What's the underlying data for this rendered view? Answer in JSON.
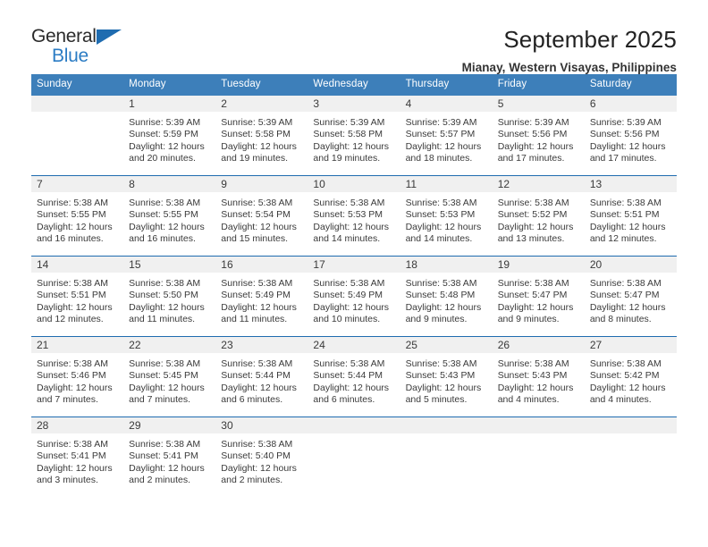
{
  "logo": {
    "text_top": "General",
    "text_bottom": "Blue",
    "triangle_icon": "blue-triangle-icon",
    "color_blue": "#2b7cc4",
    "color_dark": "#2b2b2b"
  },
  "header": {
    "title": "September 2025",
    "subtitle": "Mianay, Western Visayas, Philippines"
  },
  "theme": {
    "header_blue": "#3d7fba",
    "divider_blue": "#1f6cb0",
    "day_band_gray": "#f0f0f0"
  },
  "weekdays": [
    "Sunday",
    "Monday",
    "Tuesday",
    "Wednesday",
    "Thursday",
    "Friday",
    "Saturday"
  ],
  "labels": {
    "sunrise_prefix": "Sunrise: ",
    "sunset_prefix": "Sunset: ",
    "daylight_prefix": "Daylight: "
  },
  "weeks": [
    [
      {
        "day": "",
        "empty": true
      },
      {
        "day": "1",
        "sunrise": "Sunrise: 5:39 AM",
        "sunset": "Sunset: 5:59 PM",
        "daylight_l1": "Daylight: 12 hours",
        "daylight_l2": "and 20 minutes."
      },
      {
        "day": "2",
        "sunrise": "Sunrise: 5:39 AM",
        "sunset": "Sunset: 5:58 PM",
        "daylight_l1": "Daylight: 12 hours",
        "daylight_l2": "and 19 minutes."
      },
      {
        "day": "3",
        "sunrise": "Sunrise: 5:39 AM",
        "sunset": "Sunset: 5:58 PM",
        "daylight_l1": "Daylight: 12 hours",
        "daylight_l2": "and 19 minutes."
      },
      {
        "day": "4",
        "sunrise": "Sunrise: 5:39 AM",
        "sunset": "Sunset: 5:57 PM",
        "daylight_l1": "Daylight: 12 hours",
        "daylight_l2": "and 18 minutes."
      },
      {
        "day": "5",
        "sunrise": "Sunrise: 5:39 AM",
        "sunset": "Sunset: 5:56 PM",
        "daylight_l1": "Daylight: 12 hours",
        "daylight_l2": "and 17 minutes."
      },
      {
        "day": "6",
        "sunrise": "Sunrise: 5:39 AM",
        "sunset": "Sunset: 5:56 PM",
        "daylight_l1": "Daylight: 12 hours",
        "daylight_l2": "and 17 minutes."
      }
    ],
    [
      {
        "day": "7",
        "sunrise": "Sunrise: 5:38 AM",
        "sunset": "Sunset: 5:55 PM",
        "daylight_l1": "Daylight: 12 hours",
        "daylight_l2": "and 16 minutes."
      },
      {
        "day": "8",
        "sunrise": "Sunrise: 5:38 AM",
        "sunset": "Sunset: 5:55 PM",
        "daylight_l1": "Daylight: 12 hours",
        "daylight_l2": "and 16 minutes."
      },
      {
        "day": "9",
        "sunrise": "Sunrise: 5:38 AM",
        "sunset": "Sunset: 5:54 PM",
        "daylight_l1": "Daylight: 12 hours",
        "daylight_l2": "and 15 minutes."
      },
      {
        "day": "10",
        "sunrise": "Sunrise: 5:38 AM",
        "sunset": "Sunset: 5:53 PM",
        "daylight_l1": "Daylight: 12 hours",
        "daylight_l2": "and 14 minutes."
      },
      {
        "day": "11",
        "sunrise": "Sunrise: 5:38 AM",
        "sunset": "Sunset: 5:53 PM",
        "daylight_l1": "Daylight: 12 hours",
        "daylight_l2": "and 14 minutes."
      },
      {
        "day": "12",
        "sunrise": "Sunrise: 5:38 AM",
        "sunset": "Sunset: 5:52 PM",
        "daylight_l1": "Daylight: 12 hours",
        "daylight_l2": "and 13 minutes."
      },
      {
        "day": "13",
        "sunrise": "Sunrise: 5:38 AM",
        "sunset": "Sunset: 5:51 PM",
        "daylight_l1": "Daylight: 12 hours",
        "daylight_l2": "and 12 minutes."
      }
    ],
    [
      {
        "day": "14",
        "sunrise": "Sunrise: 5:38 AM",
        "sunset": "Sunset: 5:51 PM",
        "daylight_l1": "Daylight: 12 hours",
        "daylight_l2": "and 12 minutes."
      },
      {
        "day": "15",
        "sunrise": "Sunrise: 5:38 AM",
        "sunset": "Sunset: 5:50 PM",
        "daylight_l1": "Daylight: 12 hours",
        "daylight_l2": "and 11 minutes."
      },
      {
        "day": "16",
        "sunrise": "Sunrise: 5:38 AM",
        "sunset": "Sunset: 5:49 PM",
        "daylight_l1": "Daylight: 12 hours",
        "daylight_l2": "and 11 minutes."
      },
      {
        "day": "17",
        "sunrise": "Sunrise: 5:38 AM",
        "sunset": "Sunset: 5:49 PM",
        "daylight_l1": "Daylight: 12 hours",
        "daylight_l2": "and 10 minutes."
      },
      {
        "day": "18",
        "sunrise": "Sunrise: 5:38 AM",
        "sunset": "Sunset: 5:48 PM",
        "daylight_l1": "Daylight: 12 hours",
        "daylight_l2": "and 9 minutes."
      },
      {
        "day": "19",
        "sunrise": "Sunrise: 5:38 AM",
        "sunset": "Sunset: 5:47 PM",
        "daylight_l1": "Daylight: 12 hours",
        "daylight_l2": "and 9 minutes."
      },
      {
        "day": "20",
        "sunrise": "Sunrise: 5:38 AM",
        "sunset": "Sunset: 5:47 PM",
        "daylight_l1": "Daylight: 12 hours",
        "daylight_l2": "and 8 minutes."
      }
    ],
    [
      {
        "day": "21",
        "sunrise": "Sunrise: 5:38 AM",
        "sunset": "Sunset: 5:46 PM",
        "daylight_l1": "Daylight: 12 hours",
        "daylight_l2": "and 7 minutes."
      },
      {
        "day": "22",
        "sunrise": "Sunrise: 5:38 AM",
        "sunset": "Sunset: 5:45 PM",
        "daylight_l1": "Daylight: 12 hours",
        "daylight_l2": "and 7 minutes."
      },
      {
        "day": "23",
        "sunrise": "Sunrise: 5:38 AM",
        "sunset": "Sunset: 5:44 PM",
        "daylight_l1": "Daylight: 12 hours",
        "daylight_l2": "and 6 minutes."
      },
      {
        "day": "24",
        "sunrise": "Sunrise: 5:38 AM",
        "sunset": "Sunset: 5:44 PM",
        "daylight_l1": "Daylight: 12 hours",
        "daylight_l2": "and 6 minutes."
      },
      {
        "day": "25",
        "sunrise": "Sunrise: 5:38 AM",
        "sunset": "Sunset: 5:43 PM",
        "daylight_l1": "Daylight: 12 hours",
        "daylight_l2": "and 5 minutes."
      },
      {
        "day": "26",
        "sunrise": "Sunrise: 5:38 AM",
        "sunset": "Sunset: 5:43 PM",
        "daylight_l1": "Daylight: 12 hours",
        "daylight_l2": "and 4 minutes."
      },
      {
        "day": "27",
        "sunrise": "Sunrise: 5:38 AM",
        "sunset": "Sunset: 5:42 PM",
        "daylight_l1": "Daylight: 12 hours",
        "daylight_l2": "and 4 minutes."
      }
    ],
    [
      {
        "day": "28",
        "sunrise": "Sunrise: 5:38 AM",
        "sunset": "Sunset: 5:41 PM",
        "daylight_l1": "Daylight: 12 hours",
        "daylight_l2": "and 3 minutes."
      },
      {
        "day": "29",
        "sunrise": "Sunrise: 5:38 AM",
        "sunset": "Sunset: 5:41 PM",
        "daylight_l1": "Daylight: 12 hours",
        "daylight_l2": "and 2 minutes."
      },
      {
        "day": "30",
        "sunrise": "Sunrise: 5:38 AM",
        "sunset": "Sunset: 5:40 PM",
        "daylight_l1": "Daylight: 12 hours",
        "daylight_l2": "and 2 minutes."
      },
      {
        "day": "",
        "empty": true
      },
      {
        "day": "",
        "empty": true
      },
      {
        "day": "",
        "empty": true
      },
      {
        "day": "",
        "empty": true
      }
    ]
  ]
}
